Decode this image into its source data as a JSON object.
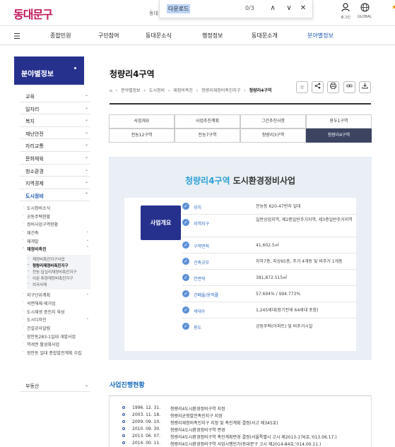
{
  "header": {
    "logo": "동대문구",
    "search_text": "동대",
    "findbar": {
      "query": "다운로드",
      "count": "0/3",
      "up": "∧",
      "down": "∨",
      "close": "✕"
    },
    "login_label": "로그인",
    "global_label": "GLOBAL"
  },
  "gnb": {
    "items": [
      "종합민원",
      "구민참여",
      "동대문소식",
      "행정정보",
      "동대문소개",
      "분야별정보"
    ]
  },
  "sidebar": {
    "title": "분야별정보",
    "items": [
      {
        "label": "교육"
      },
      {
        "label": "일자리"
      },
      {
        "label": "복지"
      },
      {
        "label": "재난안전"
      },
      {
        "label": "자리교통"
      },
      {
        "label": "문화체육"
      },
      {
        "label": "청소환경"
      },
      {
        "label": "지역경제"
      },
      {
        "label": "도시정비"
      }
    ],
    "sub_items": [
      {
        "label": "도시정비소식"
      },
      {
        "label": "공동주택현황"
      },
      {
        "label": "정비사업구역현황"
      },
      {
        "label": "재건축"
      },
      {
        "label": "재개발"
      },
      {
        "label": "재정비촉진"
      }
    ],
    "subsub_items": [
      {
        "label": "재정비촉진지구사업"
      },
      {
        "label": "청량리재정비촉진지구"
      },
      {
        "label": "전농·답십리재정비촉진지구"
      },
      {
        "label": "이문·휘경재정비촉진지구"
      },
      {
        "label": "외국사례"
      }
    ],
    "more_items": [
      {
        "label": "지구단위계획"
      },
      {
        "label": "석면해체·제거업"
      },
      {
        "label": "도시재생 증진지 육성"
      },
      {
        "label": "도시디자인"
      },
      {
        "label": "건설공사알림"
      },
      {
        "label": "장안동283-1일대 개발사업"
      },
      {
        "label": "역세권 활성화사업"
      },
      {
        "label": "장안동 일대 종합발전계획 수립"
      }
    ],
    "bottom_item": "부동산"
  },
  "main": {
    "title": "청량리4구역",
    "breadcrumb": [
      "분야별정보",
      "도시정비",
      "재정비촉진",
      "청량리재정비촉진지구",
      "청량리4구역"
    ],
    "tabs": [
      "사업개요",
      "사업추진계획",
      "그간추진사항",
      "용두1구역",
      "전농12구역",
      "전농7구역",
      "청량리3구역",
      "청량리4구역"
    ],
    "panel_heading_accent": "청량리4구역",
    "panel_heading_rest": "도시환경정비사업",
    "card_label": "사업개요",
    "info": [
      {
        "k": "위치",
        "v": "전농동 620-47번지 일대"
      },
      {
        "k": "지역지구",
        "v": "일반상업지역, 제2종일반주거지역, 제3종일반주거지역"
      },
      {
        "k": "구역면적",
        "v": "41,602.5㎡"
      },
      {
        "k": "건축규모",
        "v": "지하7층, 지상65층, 주거 4개동 및 비주거 1개동"
      },
      {
        "k": "연면적",
        "v": "381,872.515㎡"
      },
      {
        "k": "건폐율/용적률",
        "v": "57.694% / 994.773%"
      },
      {
        "k": "세대수",
        "v": "1,245세대(장기전세 64세대 포함)"
      },
      {
        "k": "용도",
        "v": "공동주택(아파트) 및 비주거시설"
      }
    ],
    "history_title": "사업진행현황",
    "history": [
      {
        "d": "1996. 12. 31.",
        "t": "청량리4도시환경정비구역 지정"
      },
      {
        "d": "2003. 11. 18.",
        "t": "청량리균형발전촉진지구 지정"
      },
      {
        "d": "2009. 09. 10.",
        "t": "청량리재정비촉진지구 지정 및 촉진계획 결정(서고 제345호)"
      },
      {
        "d": "2010. 09. 30.",
        "t": "청량리4도시환경정비구역 변경"
      },
      {
        "d": "2013. 06. 07.",
        "t": "청량리4도시환경정비구역 촉진계획변경 결정(서울특별시 고시 제2013-176호,'013.06.17.)"
      },
      {
        "d": "2014. 00. 11.",
        "t": "청량리4도시환경정비구역 사업시행인가(동대문구 고시 제2014-84호,'014.00.11.)"
      }
    ]
  },
  "colors": {
    "brand": "#26318e",
    "accent": "#2e9fd8",
    "link": "#1a56b0",
    "tab_active": "#3c4462",
    "panel_bg": "#e9eff4",
    "logo": "#c2185b"
  },
  "icons": {
    "menu": "hamburger-icon",
    "login": "user-icon",
    "global": "globe-icon",
    "home": "home-icon",
    "favorite": "star-icon",
    "share": "share-icon",
    "print": "print-icon",
    "link": "link-icon",
    "download": "download-icon"
  }
}
